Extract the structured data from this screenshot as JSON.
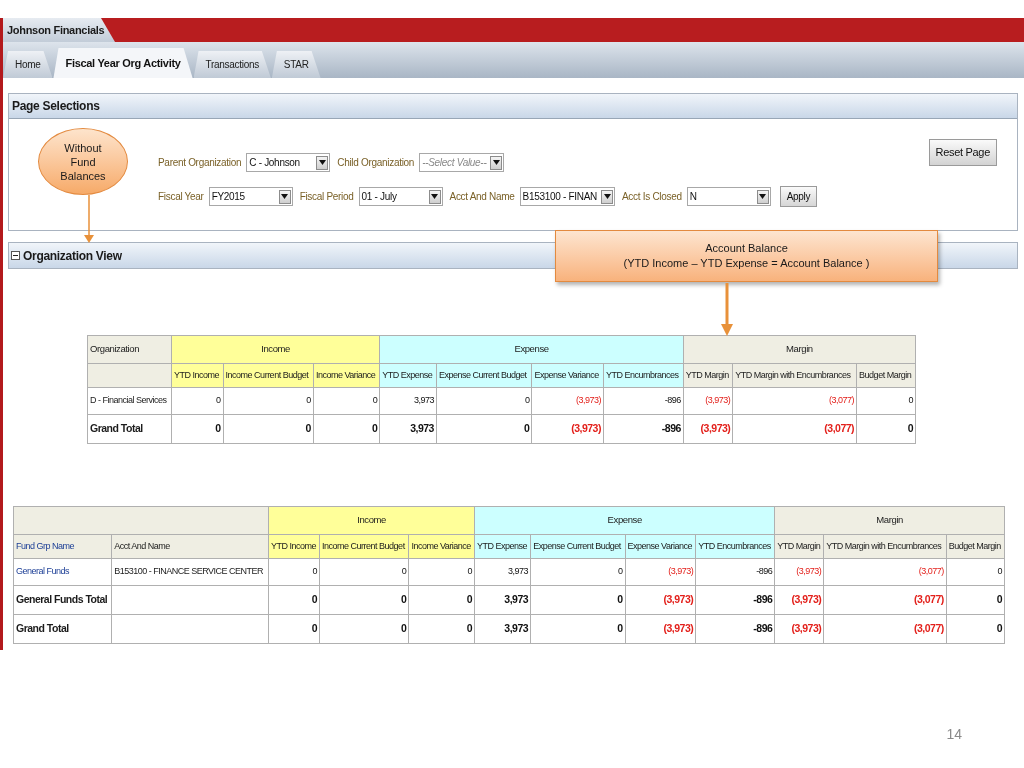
{
  "app": {
    "title": "Johnson Financials"
  },
  "tabs": [
    {
      "label": "Home",
      "selected": false
    },
    {
      "label": "Fiscal Year Org Activity",
      "selected": true
    },
    {
      "label": "Transactions",
      "selected": false
    },
    {
      "label": "STAR",
      "selected": false
    }
  ],
  "page_selections": {
    "title": "Page Selections",
    "rows": [
      {
        "filters": [
          {
            "label": "Parent Organization",
            "value": "C - Johnson"
          },
          {
            "label": "Child Organization",
            "placeholder": "--Select Value--"
          }
        ]
      },
      {
        "filters": [
          {
            "label": "Fiscal Year",
            "value": "FY2015"
          },
          {
            "label": "Fiscal Period",
            "value": "01 - July"
          },
          {
            "label": "Acct And Name",
            "value": "B153100 - FINAN"
          },
          {
            "label": "Acct Is Closed",
            "value": "N"
          }
        ]
      }
    ],
    "apply_button": "Apply",
    "reset_button": "Reset Page"
  },
  "organization_view": {
    "title": "Organization View",
    "expanded": true,
    "table": {
      "lead_columns": [
        {
          "group_label": "Organization"
        }
      ],
      "groups": [
        {
          "label": "Income",
          "color": "#ffff99",
          "columns": [
            "YTD Income",
            "Income Current Budget",
            "Income Variance"
          ]
        },
        {
          "label": "Expense",
          "color": "#ccffff",
          "columns": [
            "YTD Expense",
            "Expense Current Budget",
            "Expense Variance",
            "YTD Encumbrances"
          ]
        },
        {
          "label": "Margin",
          "color": "#efeee3",
          "columns": [
            "YTD Margin",
            "YTD Margin with Encumbrances",
            "Budget Margin"
          ]
        }
      ],
      "rows": [
        {
          "kind": "detail",
          "lead": [
            {
              "text": "D - Financial Services",
              "link": false
            }
          ],
          "cells": [
            {
              "text": "0",
              "negative": false
            },
            {
              "text": "0",
              "negative": false
            },
            {
              "text": "0",
              "negative": false
            },
            {
              "text": "3,973",
              "negative": false
            },
            {
              "text": "0",
              "negative": false
            },
            {
              "text": "(3,973)",
              "negative": true
            },
            {
              "text": "-896",
              "negative": false
            },
            {
              "text": "(3,973)",
              "negative": true
            },
            {
              "text": "(3,077)",
              "negative": true
            },
            {
              "text": "0",
              "negative": false
            }
          ]
        },
        {
          "kind": "total",
          "lead": [
            {
              "text": "Grand Total",
              "link": false
            }
          ],
          "cells": [
            {
              "text": "0",
              "negative": false
            },
            {
              "text": "0",
              "negative": false
            },
            {
              "text": "0",
              "negative": false
            },
            {
              "text": "3,973",
              "negative": false
            },
            {
              "text": "0",
              "negative": false
            },
            {
              "text": "(3,973)",
              "negative": true
            },
            {
              "text": "-896",
              "negative": false
            },
            {
              "text": "(3,973)",
              "negative": true
            },
            {
              "text": "(3,077)",
              "negative": true
            },
            {
              "text": "0",
              "negative": false
            }
          ]
        }
      ]
    }
  },
  "fund_table": {
    "lead_columns": [
      {
        "label": "Fund Grp Name",
        "link": true
      },
      {
        "label": "Acct And Name",
        "link": false
      }
    ],
    "groups": [
      {
        "label": "Income",
        "color": "#ffff99",
        "columns": [
          "YTD Income",
          "Income Current Budget",
          "Income Variance"
        ]
      },
      {
        "label": "Expense",
        "color": "#ccffff",
        "columns": [
          "YTD Expense",
          "Expense Current Budget",
          "Expense Variance",
          "YTD Encumbrances"
        ]
      },
      {
        "label": "Margin",
        "color": "#efeee3",
        "columns": [
          "YTD Margin",
          "YTD Margin with Encumbrances",
          "Budget Margin"
        ]
      }
    ],
    "rows": [
      {
        "kind": "detail",
        "lead": [
          {
            "text": "General Funds",
            "link": true
          },
          {
            "text": "B153100 - FINANCE SERVICE CENTER",
            "link": false
          }
        ],
        "cells": [
          {
            "text": "0",
            "negative": false
          },
          {
            "text": "0",
            "negative": false
          },
          {
            "text": "0",
            "negative": false
          },
          {
            "text": "3,973",
            "negative": false
          },
          {
            "text": "0",
            "negative": false
          },
          {
            "text": "(3,973)",
            "negative": true
          },
          {
            "text": "-896",
            "negative": false
          },
          {
            "text": "(3,973)",
            "negative": true
          },
          {
            "text": "(3,077)",
            "negative": true
          },
          {
            "text": "0",
            "negative": false
          }
        ]
      },
      {
        "kind": "total",
        "lead": [
          {
            "text": "General Funds Total",
            "link": false
          }
        ],
        "cells": [
          {
            "text": "0",
            "negative": false
          },
          {
            "text": "0",
            "negative": false
          },
          {
            "text": "0",
            "negative": false
          },
          {
            "text": "3,973",
            "negative": false
          },
          {
            "text": "0",
            "negative": false
          },
          {
            "text": "(3,973)",
            "negative": true
          },
          {
            "text": "-896",
            "negative": false
          },
          {
            "text": "(3,973)",
            "negative": true
          },
          {
            "text": "(3,077)",
            "negative": true
          },
          {
            "text": "0",
            "negative": false
          }
        ]
      },
      {
        "kind": "total",
        "lead": [
          {
            "text": "Grand Total",
            "link": false
          }
        ],
        "cells": [
          {
            "text": "0",
            "negative": false
          },
          {
            "text": "0",
            "negative": false
          },
          {
            "text": "0",
            "negative": false
          },
          {
            "text": "3,973",
            "negative": false
          },
          {
            "text": "0",
            "negative": false
          },
          {
            "text": "(3,973)",
            "negative": true
          },
          {
            "text": "-896",
            "negative": false
          },
          {
            "text": "(3,973)",
            "negative": true
          },
          {
            "text": "(3,077)",
            "negative": true
          },
          {
            "text": "0",
            "negative": false
          }
        ]
      }
    ]
  },
  "callouts": [
    {
      "kind": "ellipse",
      "text": "Without Fund Balances"
    },
    {
      "kind": "box",
      "title": "Account Balance",
      "text": "(YTD Income – YTD Expense = Account Balance )"
    }
  ],
  "slide_number": "14"
}
